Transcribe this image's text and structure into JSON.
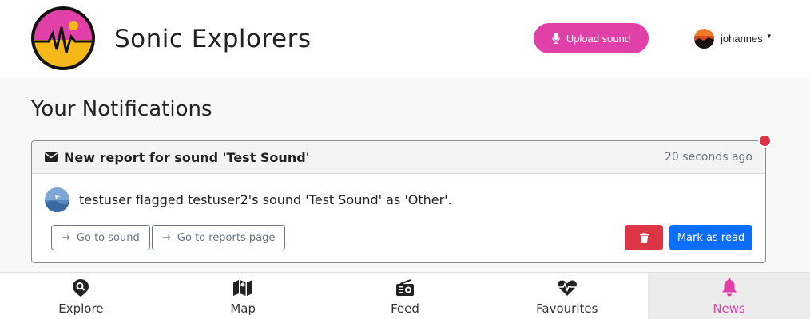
{
  "header": {
    "brand": "Sonic Explorers",
    "upload_label": "Upload sound",
    "username": "johannes",
    "accent_color": "#e040a8"
  },
  "page": {
    "title": "Your Notifications"
  },
  "notification": {
    "title": "New report for sound 'Test Sound'",
    "time": "20 seconds ago",
    "message": "testuser flagged testuser2's sound 'Test Sound' as 'Other'.",
    "go_to_sound_label": "Go to sound",
    "go_to_reports_label": "Go to reports page",
    "mark_read_label": "Mark as read"
  },
  "tabs": [
    {
      "label": "Explore",
      "icon": "location-search-icon"
    },
    {
      "label": "Map",
      "icon": "map-icon"
    },
    {
      "label": "Feed",
      "icon": "radio-icon"
    },
    {
      "label": "Favourites",
      "icon": "heart-pulse-icon"
    },
    {
      "label": "News",
      "icon": "bell-icon",
      "active": true
    }
  ]
}
